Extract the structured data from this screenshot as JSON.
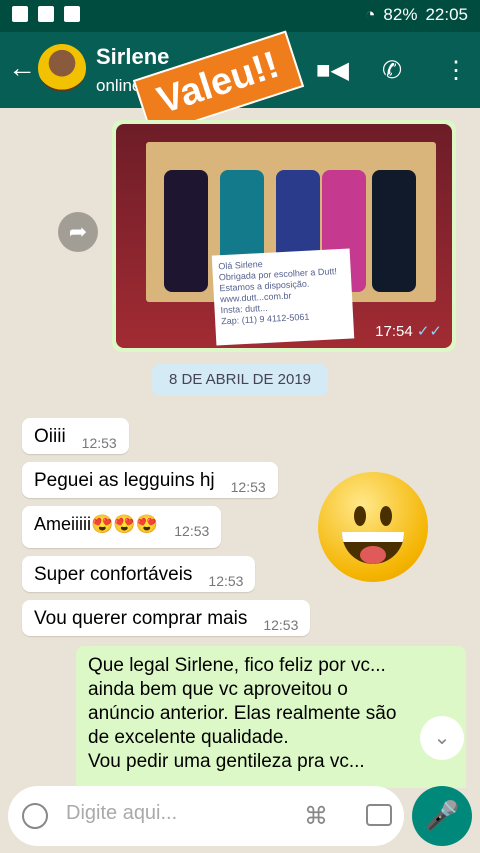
{
  "status_bar": {
    "battery": "82%",
    "time": "22:05"
  },
  "header": {
    "contact_name": "Sirlene",
    "status": "online",
    "sticker": "Valeu!!"
  },
  "image_message": {
    "time": "17:54",
    "card_lines": [
      "Olá Sirlene",
      "Obrigada por escolher a Dutt!",
      "Estamos a disposição.",
      "www.dutt...com.br",
      "Insta: dutt...",
      "Zap: (11) 9 4112-5061"
    ]
  },
  "date_chip": "8 DE ABRIL DE 2019",
  "incoming": [
    {
      "text": "Oiiii",
      "time": "12:53"
    },
    {
      "text": "Peguei as legguins hj",
      "time": "12:53"
    },
    {
      "text": "Ameiiiii😍😍😍",
      "time": "12:53"
    },
    {
      "text": "Super confortáveis",
      "time": "12:53"
    },
    {
      "text": "Vou querer comprar mais",
      "time": "12:53"
    }
  ],
  "outgoing": {
    "lines": [
      "Que legal Sirlene, fico feliz por vc...",
      "ainda bem que vc aproveitou o",
      "anúncio anterior. Elas realmente são",
      "de excelente qualidade.",
      "Vou pedir uma gentileza pra vc..."
    ]
  },
  "composer": {
    "placeholder": "Digite aqui..."
  },
  "icons": {
    "back": "arrow-left-icon",
    "video": "video-call-icon",
    "call": "phone-icon",
    "menu": "more-vert-icon",
    "forward": "forward-icon",
    "emoji": "emoji-icon",
    "attach": "paperclip-icon",
    "camera": "camera-icon",
    "mic": "mic-icon"
  },
  "colors": {
    "header": "#075e54",
    "outgoing": "#dcf8c6",
    "incoming": "#ffffff",
    "mic": "#00897b"
  }
}
